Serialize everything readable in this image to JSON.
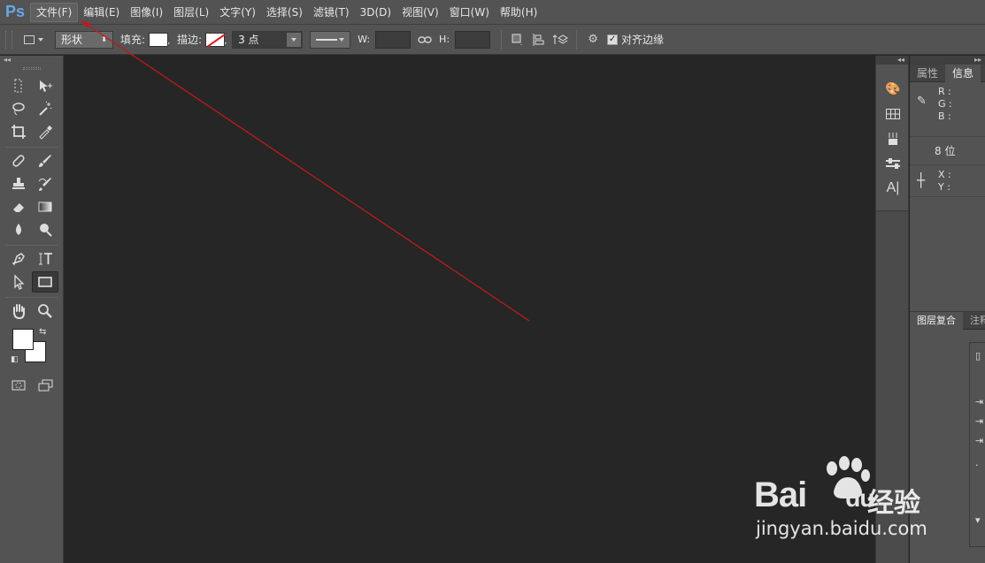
{
  "app": {
    "logo": "Ps"
  },
  "menu": [
    {
      "label": "文件(F)",
      "active": true
    },
    {
      "label": "编辑(E)"
    },
    {
      "label": "图像(I)"
    },
    {
      "label": "图层(L)"
    },
    {
      "label": "文字(Y)"
    },
    {
      "label": "选择(S)"
    },
    {
      "label": "滤镜(T)"
    },
    {
      "label": "3D(D)"
    },
    {
      "label": "视图(V)"
    },
    {
      "label": "窗口(W)"
    },
    {
      "label": "帮助(H)"
    }
  ],
  "options": {
    "mode_value": "形状",
    "fill_label": "填充:",
    "stroke_label": "描边:",
    "stroke_width_value": "3 点",
    "w_label": "W:",
    "h_label": "H:",
    "align_edges_label": "对齐边缘",
    "align_edges_checked": true
  },
  "panels": {
    "tabs_top": [
      "属性",
      "信息"
    ],
    "info": {
      "r": "R :",
      "g": "G :",
      "b": "B :",
      "bits": "8 位",
      "x": "X :",
      "y": "Y :"
    },
    "tabs_bottom": [
      "图层复合",
      "注释"
    ]
  },
  "annotation": {
    "color": "#c01a1a"
  },
  "watermark": {
    "brand": "Bai",
    "brand2": "du",
    "suffix": "经验",
    "url": "jingyan.baidu.com"
  }
}
